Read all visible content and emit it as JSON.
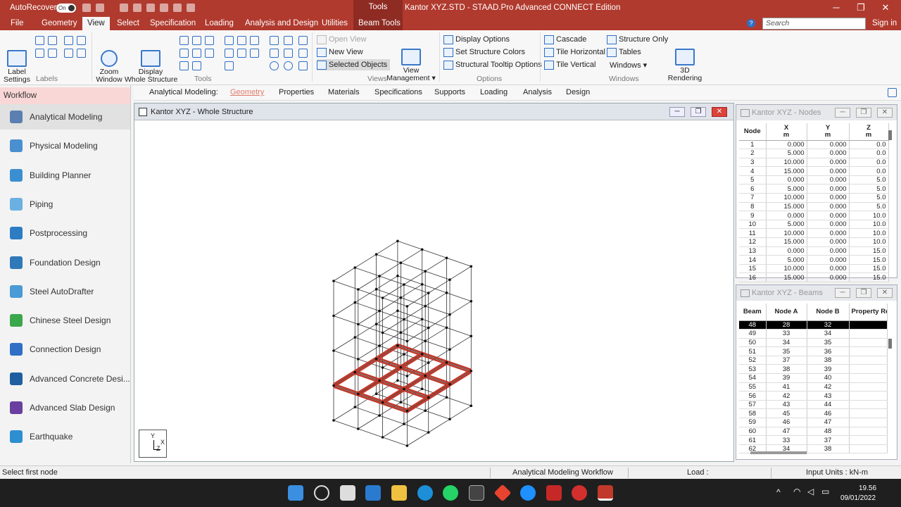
{
  "titlebar": {
    "autorecovery": "AutoRecovery",
    "toggle": "On",
    "tools": "Tools",
    "title": "Kantor XYZ.STD - STAAD.Pro Advanced CONNECT Edition",
    "min": "─",
    "max": "❐",
    "close": "✕"
  },
  "tabs": [
    "File",
    "Geometry",
    "View",
    "Select",
    "Specification",
    "Loading",
    "Analysis and Design",
    "Utilities",
    "Beam Tools"
  ],
  "search": {
    "placeholder": "Search"
  },
  "signin": "Sign in",
  "ribbon": {
    "label_settings": "Label\nSettings",
    "zoom_window": "Zoom\nWindow",
    "display_whole": "Display\nWhole Structure",
    "open_view": "Open View",
    "new_view": "New View",
    "selected_objects": "Selected Objects",
    "view_management": "View\nManagement ▾",
    "display_options": "Display Options",
    "set_colors": "Set Structure Colors",
    "tooltip_options": "Structural Tooltip Options",
    "cascade": "Cascade",
    "tile_h": "Tile Horizontal",
    "tile_v": "Tile Vertical",
    "structure_only": "Structure Only",
    "tables": "Tables",
    "windows": "Windows ▾",
    "rendering": "3D\nRendering",
    "groups": {
      "labels": "Labels",
      "tools": "Tools",
      "views": "Views",
      "options": "Options",
      "windows": "Windows"
    }
  },
  "workflow": {
    "title": "Workflow",
    "items": [
      {
        "label": "Analytical Modeling",
        "color": "#5a7fb0"
      },
      {
        "label": "Physical Modeling",
        "color": "#4a8fcf"
      },
      {
        "label": "Building Planner",
        "color": "#3b8fd1"
      },
      {
        "label": "Piping",
        "color": "#6ab0e0"
      },
      {
        "label": "Postprocessing",
        "color": "#2d7cc4"
      },
      {
        "label": "Foundation Design",
        "color": "#2f79b8"
      },
      {
        "label": "Steel AutoDrafter",
        "color": "#4a9ad6"
      },
      {
        "label": "Chinese Steel Design",
        "color": "#3aa84a"
      },
      {
        "label": "Connection Design",
        "color": "#2f6fc5"
      },
      {
        "label": "Advanced Concrete Desi...",
        "color": "#1f5fa0"
      },
      {
        "label": "Advanced Slab Design",
        "color": "#6a3fa0"
      },
      {
        "label": "Earthquake",
        "color": "#2d8fd0"
      }
    ]
  },
  "subtabs": {
    "prefix": "Analytical Modeling:",
    "items": [
      "Geometry",
      "Properties",
      "Materials",
      "Specifications",
      "Supports",
      "Loading",
      "Analysis",
      "Design"
    ]
  },
  "viewport": {
    "title": "Kantor XYZ - Whole Structure",
    "axis_y": "Y",
    "axis_x": "X",
    "axis_z": "Z"
  },
  "nodes": {
    "title": "Kantor XYZ - Nodes",
    "headers": [
      "Node",
      "X\nm",
      "Y\nm",
      "Z\nm"
    ],
    "rows": [
      [
        "1",
        "0.000",
        "0.000",
        "0.0"
      ],
      [
        "2",
        "5.000",
        "0.000",
        "0.0"
      ],
      [
        "3",
        "10.000",
        "0.000",
        "0.0"
      ],
      [
        "4",
        "15.000",
        "0.000",
        "0.0"
      ],
      [
        "5",
        "0.000",
        "0.000",
        "5.0"
      ],
      [
        "6",
        "5.000",
        "0.000",
        "5.0"
      ],
      [
        "7",
        "10.000",
        "0.000",
        "5.0"
      ],
      [
        "8",
        "15.000",
        "0.000",
        "5.0"
      ],
      [
        "9",
        "0.000",
        "0.000",
        "10.0"
      ],
      [
        "10",
        "5.000",
        "0.000",
        "10.0"
      ],
      [
        "11",
        "10.000",
        "0.000",
        "10.0"
      ],
      [
        "12",
        "15.000",
        "0.000",
        "10.0"
      ],
      [
        "13",
        "0.000",
        "0.000",
        "15.0"
      ],
      [
        "14",
        "5.000",
        "0.000",
        "15.0"
      ],
      [
        "15",
        "10.000",
        "0.000",
        "15.0"
      ],
      [
        "16",
        "15.000",
        "0.000",
        "15.0"
      ]
    ]
  },
  "beams": {
    "title": "Kantor XYZ - Beams",
    "headers": [
      "Beam",
      "Node A",
      "Node B",
      "Property Re"
    ],
    "rows": [
      [
        "48",
        "28",
        "32"
      ],
      [
        "49",
        "33",
        "34"
      ],
      [
        "50",
        "34",
        "35"
      ],
      [
        "51",
        "35",
        "36"
      ],
      [
        "52",
        "37",
        "38"
      ],
      [
        "53",
        "38",
        "39"
      ],
      [
        "54",
        "39",
        "40"
      ],
      [
        "55",
        "41",
        "42"
      ],
      [
        "56",
        "42",
        "43"
      ],
      [
        "57",
        "43",
        "44"
      ],
      [
        "58",
        "45",
        "46"
      ],
      [
        "59",
        "46",
        "47"
      ],
      [
        "60",
        "47",
        "48"
      ],
      [
        "61",
        "33",
        "37"
      ],
      [
        "62",
        "34",
        "38"
      ]
    ]
  },
  "status": {
    "left": "Select first node",
    "workflow": "Analytical Modeling Workflow",
    "load": "Load :",
    "units": "Input Units : kN-m"
  },
  "taskbar": {
    "time": "19.56",
    "date": "09/01/2022"
  }
}
